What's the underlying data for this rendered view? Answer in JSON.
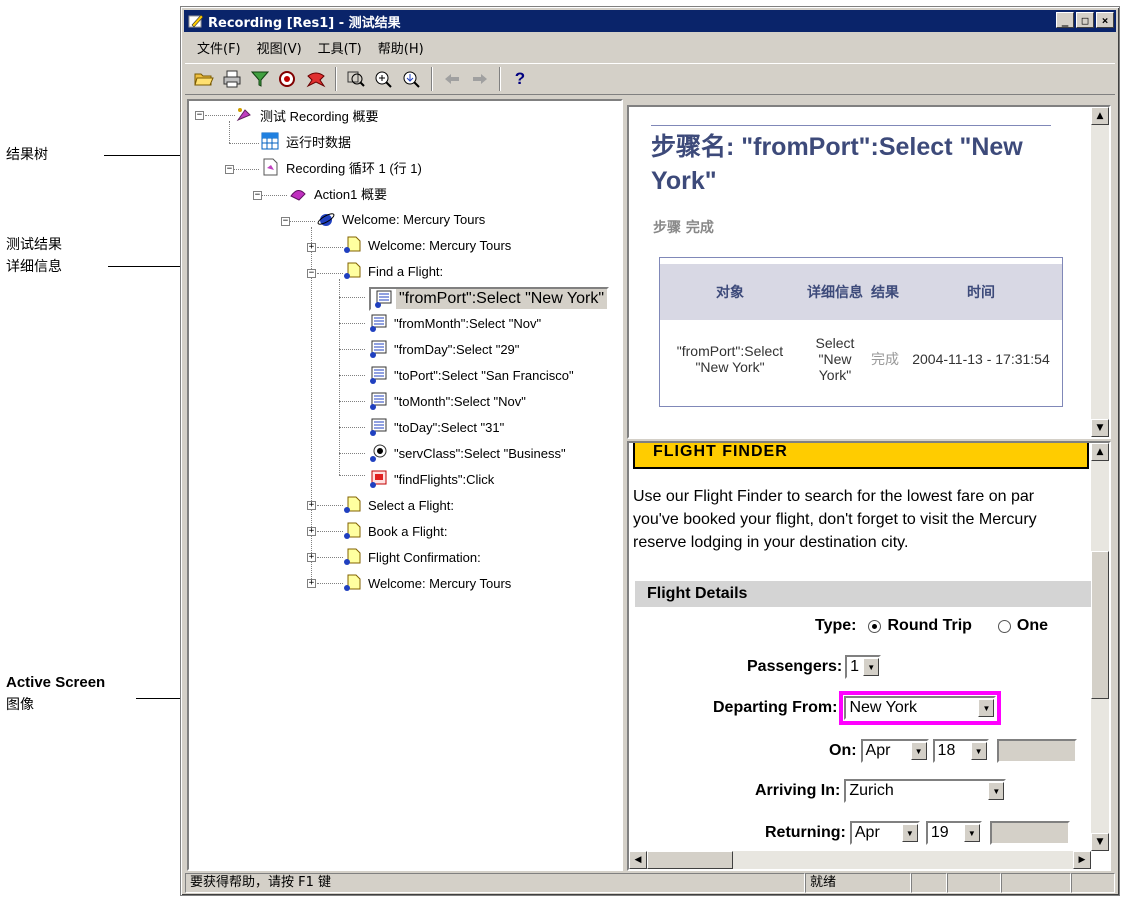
{
  "callouts": {
    "tree": "结果树",
    "details_line1": "测试结果",
    "details_line2": "详细信息",
    "active_line1": "Active Screen",
    "active_line2": "图像"
  },
  "window": {
    "title": "Recording [Res1] - 测试结果",
    "controls": [
      "_",
      "□",
      "×"
    ]
  },
  "menu": [
    "文件(F)",
    "视图(V)",
    "工具(T)",
    "帮助(H)"
  ],
  "toolbar": {
    "icons": [
      "open-folder-icon",
      "print-icon",
      "filter-icon",
      "find-icon",
      "jump-error-icon",
      "zoom-fit-icon",
      "zoom-in-icon",
      "zoom-out-icon",
      "back-arrow-icon",
      "forward-arrow-icon",
      "help-icon"
    ],
    "help_label": "?"
  },
  "tree": {
    "items": [
      {
        "label": "测试 Recording 概要",
        "icon": "test-summary-icon"
      },
      {
        "label": "运行时数据",
        "icon": "data-table-icon"
      },
      {
        "label": "Recording 循环 1 (行 1)",
        "icon": "iteration-icon"
      },
      {
        "label": "Action1 概要",
        "icon": "action-icon"
      },
      {
        "label": "Welcome: Mercury Tours",
        "icon": "browser-icon"
      },
      {
        "label": "Welcome: Mercury Tours",
        "icon": "page-icon"
      },
      {
        "label": "Find a Flight:",
        "icon": "page-icon"
      },
      {
        "label": "\"fromPort\":Select \"New York\"",
        "icon": "list-step-icon"
      },
      {
        "label": "\"fromMonth\":Select \"Nov\"",
        "icon": "list-step-icon"
      },
      {
        "label": "\"fromDay\":Select \"29\"",
        "icon": "list-step-icon"
      },
      {
        "label": "\"toPort\":Select \"San Francisco\"",
        "icon": "list-step-icon"
      },
      {
        "label": "\"toMonth\":Select \"Nov\"",
        "icon": "list-step-icon"
      },
      {
        "label": "\"toDay\":Select \"31\"",
        "icon": "list-step-icon"
      },
      {
        "label": "\"servClass\":Select \"Business\"",
        "icon": "radio-step-icon"
      },
      {
        "label": "\"findFlights\":Click",
        "icon": "image-step-icon"
      },
      {
        "label": "Select a Flight:",
        "icon": "page-icon"
      },
      {
        "label": "Book a Flight:",
        "icon": "page-icon"
      },
      {
        "label": "Flight Confirmation:",
        "icon": "page-icon"
      },
      {
        "label": "Welcome: Mercury Tours",
        "icon": "page-icon"
      }
    ]
  },
  "details": {
    "step_name": "步骤名: \"fromPort\":Select \"New York\"",
    "status": "步骤  完成",
    "columns": [
      "对象",
      "详细信息",
      "结果",
      "时间"
    ],
    "row": {
      "object": "\"fromPort\":Select \"New York\"",
      "detail": "Select \"New York\"",
      "result": "完成",
      "time": "2004-11-13 - 17:31:54"
    }
  },
  "active_screen": {
    "banner": "FLIGHT FINDER",
    "intro_lines": [
      "Use our Flight Finder to search for the lowest fare on par",
      "you've booked your flight, don't forget to visit the Mercury",
      "reserve lodging in your destination city."
    ],
    "section": "Flight Details",
    "type_label": "Type:",
    "type_options": [
      "Round Trip",
      "One"
    ],
    "passengers_label": "Passengers:",
    "passengers_value": "1",
    "departing_label": "Departing From:",
    "departing_value": "New York",
    "on_label": "On:",
    "on_month": "Apr",
    "on_day": "18",
    "arriving_label": "Arriving In:",
    "arriving_value": "Zurich",
    "returning_label": "Returning:",
    "returning_month": "Apr",
    "returning_day": "19",
    "highlight_color": "#ff00ff"
  },
  "statusbar": {
    "help": "要获得帮助，请按 F1 键",
    "state": "就绪"
  }
}
